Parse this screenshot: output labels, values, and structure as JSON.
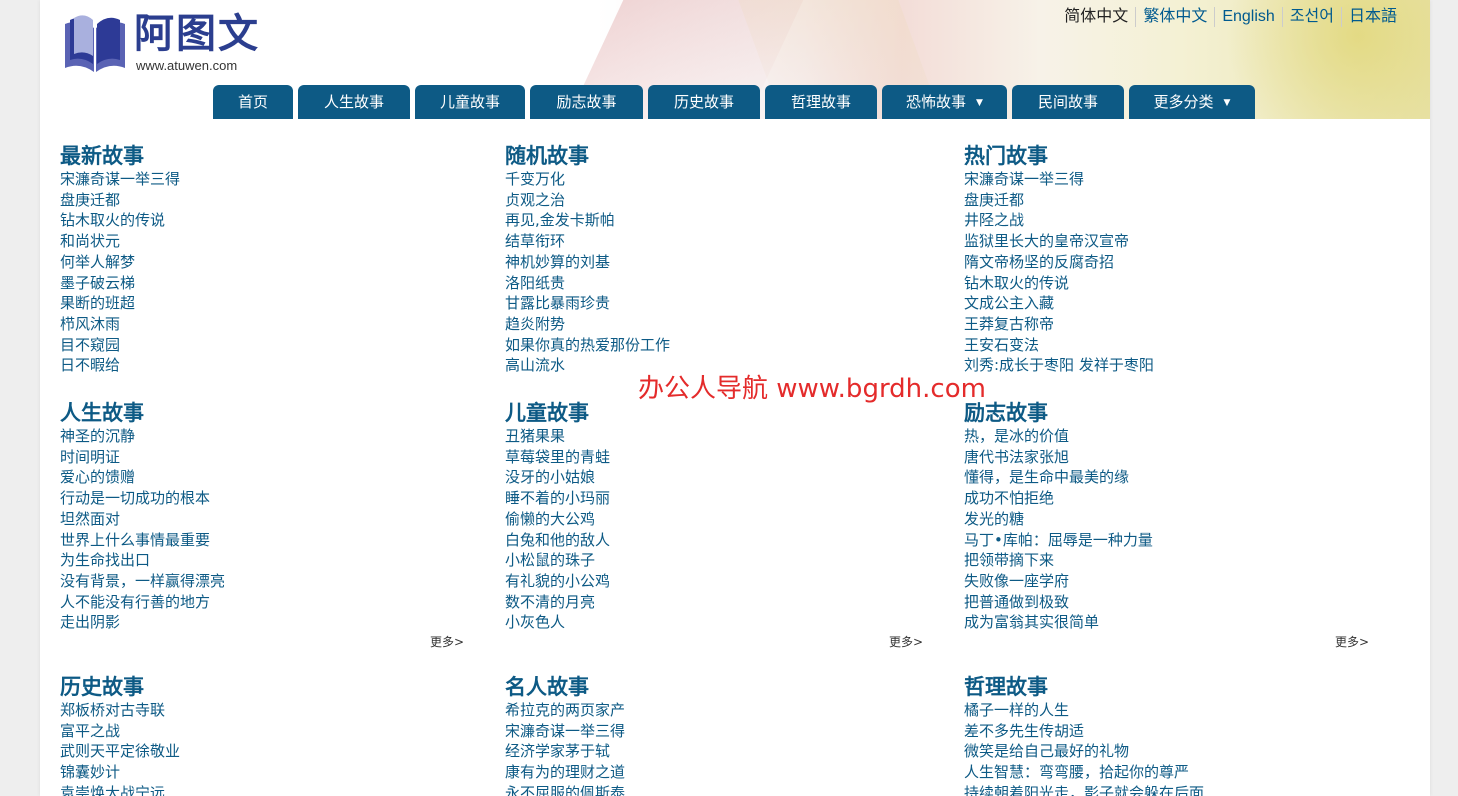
{
  "logo": {
    "title": "阿图文",
    "url": "www.atuwen.com"
  },
  "languages": [
    "简体中文",
    "繁体中文",
    "English",
    "조선어",
    "日本語"
  ],
  "nav": [
    {
      "label": "首页",
      "dropdown": false
    },
    {
      "label": "人生故事",
      "dropdown": false
    },
    {
      "label": "儿童故事",
      "dropdown": false
    },
    {
      "label": "励志故事",
      "dropdown": false
    },
    {
      "label": "历史故事",
      "dropdown": false
    },
    {
      "label": "哲理故事",
      "dropdown": false
    },
    {
      "label": "恐怖故事",
      "dropdown": true
    },
    {
      "label": "民间故事",
      "dropdown": false
    },
    {
      "label": "更多分类",
      "dropdown": true
    }
  ],
  "more_label": "更多>",
  "watermark": "办公人导航  www.bgrdh.com",
  "sections": [
    {
      "title": "最新故事",
      "items": [
        "宋濂奇谋一举三得",
        "盘庚迁都",
        "钻木取火的传说",
        "和尚状元",
        "何举人解梦",
        "墨子破云梯",
        "果断的班超",
        "栉风沐雨",
        "目不窥园",
        "日不暇给"
      ]
    },
    {
      "title": "随机故事",
      "items": [
        "千变万化",
        "贞观之治",
        "再见,金发卡斯帕",
        "结草衔环",
        "神机妙算的刘基",
        "洛阳纸贵",
        "甘露比暴雨珍贵",
        "趋炎附势",
        "如果你真的热爱那份工作",
        "高山流水"
      ]
    },
    {
      "title": "热门故事",
      "items": [
        "宋濂奇谋一举三得",
        "盘庚迁都",
        "井陉之战",
        "监狱里长大的皇帝汉宣帝",
        "隋文帝杨坚的反腐奇招",
        "钻木取火的传说",
        "文成公主入藏",
        "王莽复古称帝",
        "王安石变法",
        "刘秀:成长于枣阳 发祥于枣阳"
      ]
    },
    {
      "title": "人生故事",
      "items": [
        "神圣的沉静",
        "时间明证",
        "爱心的馈赠",
        "行动是一切成功的根本",
        "坦然面对",
        "世界上什么事情最重要",
        "为生命找出口",
        "没有背景，一样赢得漂亮",
        "人不能没有行善的地方",
        "走出阴影"
      ]
    },
    {
      "title": "儿童故事",
      "items": [
        "丑猪果果",
        "草莓袋里的青蛙",
        "没牙的小姑娘",
        "睡不着的小玛丽",
        "偷懒的大公鸡",
        "白兔和他的敌人",
        "小松鼠的珠子",
        "有礼貌的小公鸡",
        "数不清的月亮",
        "小灰色人"
      ]
    },
    {
      "title": "励志故事",
      "items": [
        "热，是冰的价值",
        "唐代书法家张旭",
        "懂得，是生命中最美的缘",
        "成功不怕拒绝",
        "发光的糖",
        "马丁•库帕：屈辱是一种力量",
        "把领带摘下来",
        "失败像一座学府",
        "把普通做到极致",
        "成为富翁其实很简单"
      ]
    },
    {
      "title": "历史故事",
      "items": [
        "郑板桥对古寺联",
        "富平之战",
        "武则天平定徐敬业",
        "锦囊妙计",
        "袁崇焕大战宁远"
      ]
    },
    {
      "title": "名人故事",
      "items": [
        "希拉克的两页家产",
        "宋濂奇谋一举三得",
        "经济学家茅于轼",
        "康有为的理财之道",
        "永不屈服的佩斯泰"
      ]
    },
    {
      "title": "哲理故事",
      "items": [
        "橘子一样的人生",
        "差不多先生传胡适",
        "微笑是给自己最好的礼物",
        "人生智慧：弯弯腰，拾起你的尊严",
        "持续朝着阳光走，影子就会躲在后面"
      ]
    }
  ]
}
